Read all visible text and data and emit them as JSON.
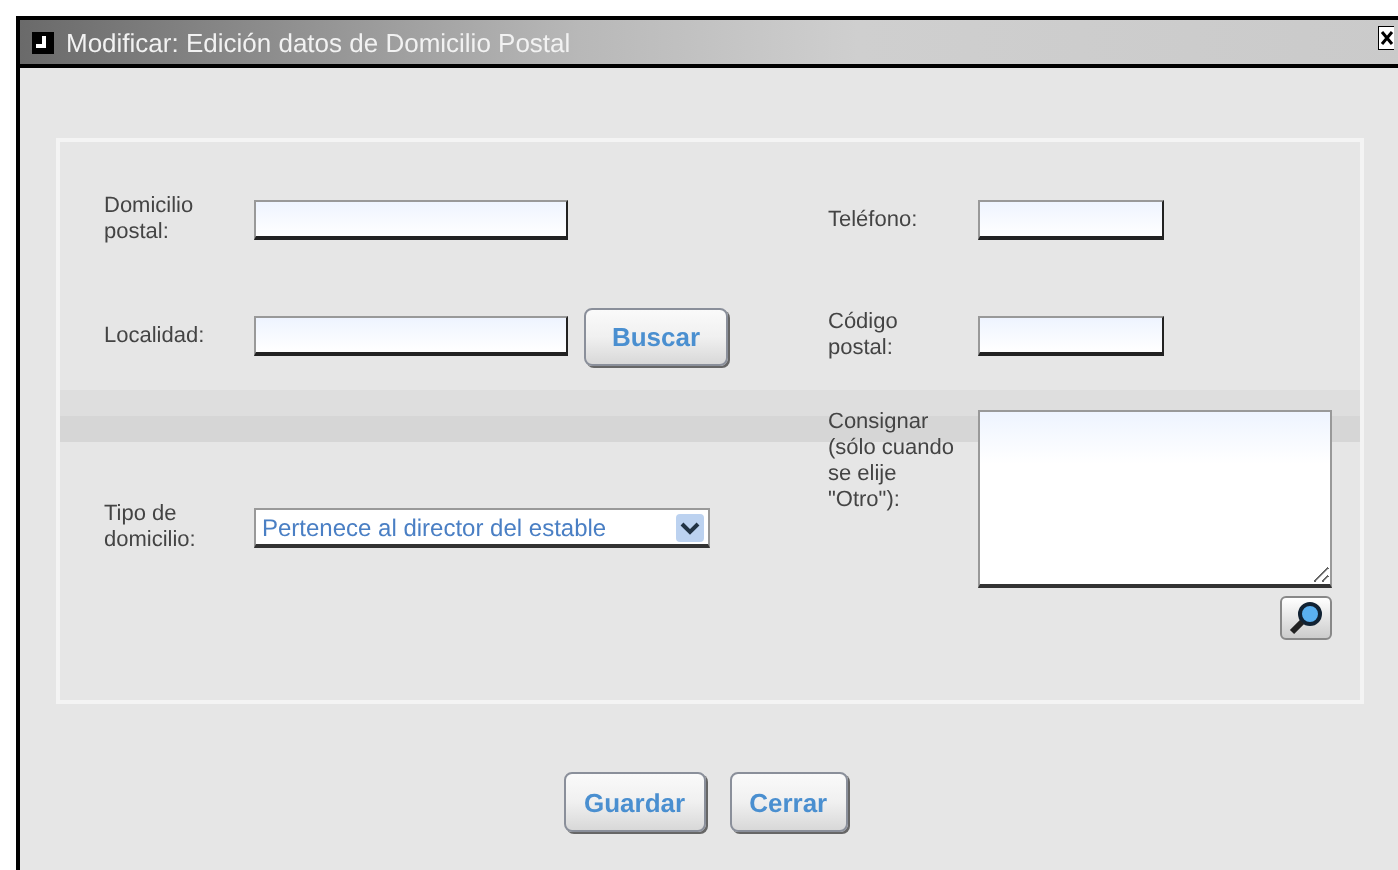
{
  "window": {
    "title": "Modificar: Edición datos de Domicilio Postal"
  },
  "left_fields": [
    {
      "kind": "text",
      "label": "Domicilio postal:"
    },
    {
      "kind": "text_search",
      "label": "Localidad:",
      "button": "Buscar"
    },
    {
      "kind": "select",
      "label": "Tipo de domicilio:",
      "value": "Pertenece al director del estable"
    }
  ],
  "right_fields": [
    {
      "kind": "text",
      "label": "Teléfono:"
    },
    {
      "kind": "text",
      "label": "Código postal:"
    },
    {
      "kind": "textarea",
      "label": "Consignar (sólo cuando se elije \"Otro\"):"
    }
  ],
  "buttons": [
    "Guardar",
    "Cerrar"
  ]
}
